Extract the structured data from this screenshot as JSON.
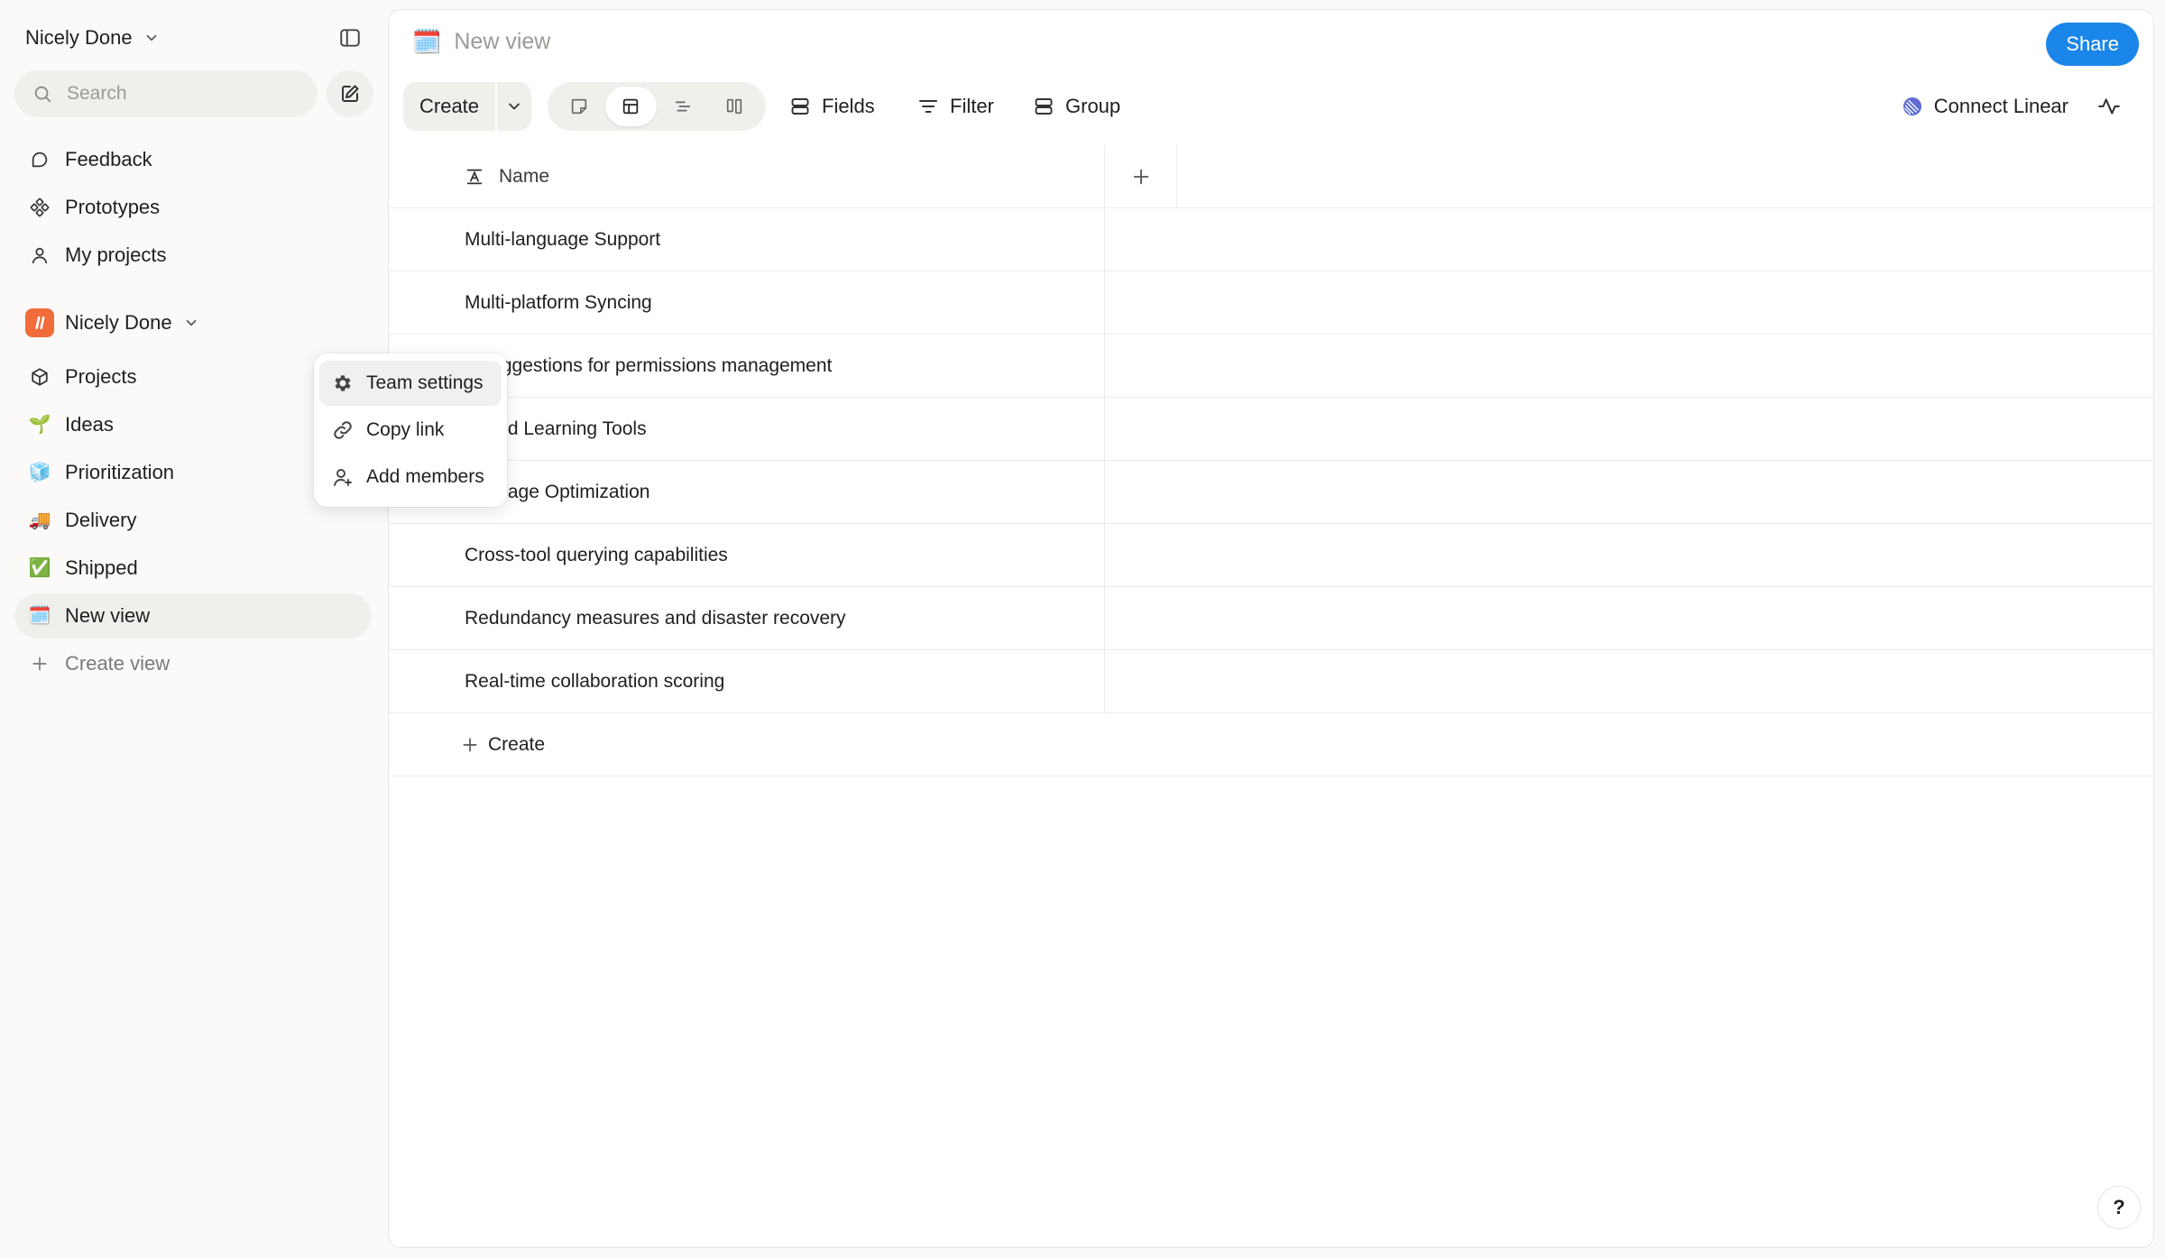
{
  "sidebar": {
    "workspace_name": "Nicely Done",
    "search_placeholder": "Search",
    "top_items": [
      {
        "label": "Feedback",
        "icon": "feedback-icon"
      },
      {
        "label": "Prototypes",
        "icon": "prototypes-icon"
      },
      {
        "label": "My projects",
        "icon": "user-icon"
      }
    ],
    "team": {
      "name": "Nicely Done",
      "items": [
        {
          "label": "Projects",
          "icon": "cube-icon"
        },
        {
          "label": "Ideas",
          "icon": "🌱"
        },
        {
          "label": "Prioritization",
          "icon": "🧊"
        },
        {
          "label": "Delivery",
          "icon": "🚚"
        },
        {
          "label": "Shipped",
          "icon": "✅"
        },
        {
          "label": "New view",
          "icon": "🗓️"
        }
      ],
      "create_view_label": "Create view"
    }
  },
  "context_menu": {
    "items": [
      {
        "label": "Team settings",
        "icon": "gear-icon"
      },
      {
        "label": "Copy link",
        "icon": "link-icon"
      },
      {
        "label": "Add members",
        "icon": "add-user-icon"
      }
    ]
  },
  "main": {
    "view_title": "New view",
    "view_icon": "🗓️",
    "share_label": "Share",
    "toolbar": {
      "create_label": "Create",
      "fields_label": "Fields",
      "filter_label": "Filter",
      "group_label": "Group",
      "connect_label": "Connect Linear",
      "active_layout": "table"
    },
    "table": {
      "column_header": "Name",
      "rows": [
        "Multi-language Support",
        "Multi-platform Syncing",
        "rt suggestions for permissions management",
        "grated Learning Tools",
        "ing Page Optimization",
        "Cross-tool querying capabilities",
        "Redundancy measures and disaster recovery",
        "Real-time collaboration scoring"
      ],
      "create_label": "Create"
    },
    "help_label": "?"
  },
  "colors": {
    "accent": "#1a86ea",
    "team_logo": "#f26b3a",
    "sidebar_bg": "#fbfaf8"
  }
}
